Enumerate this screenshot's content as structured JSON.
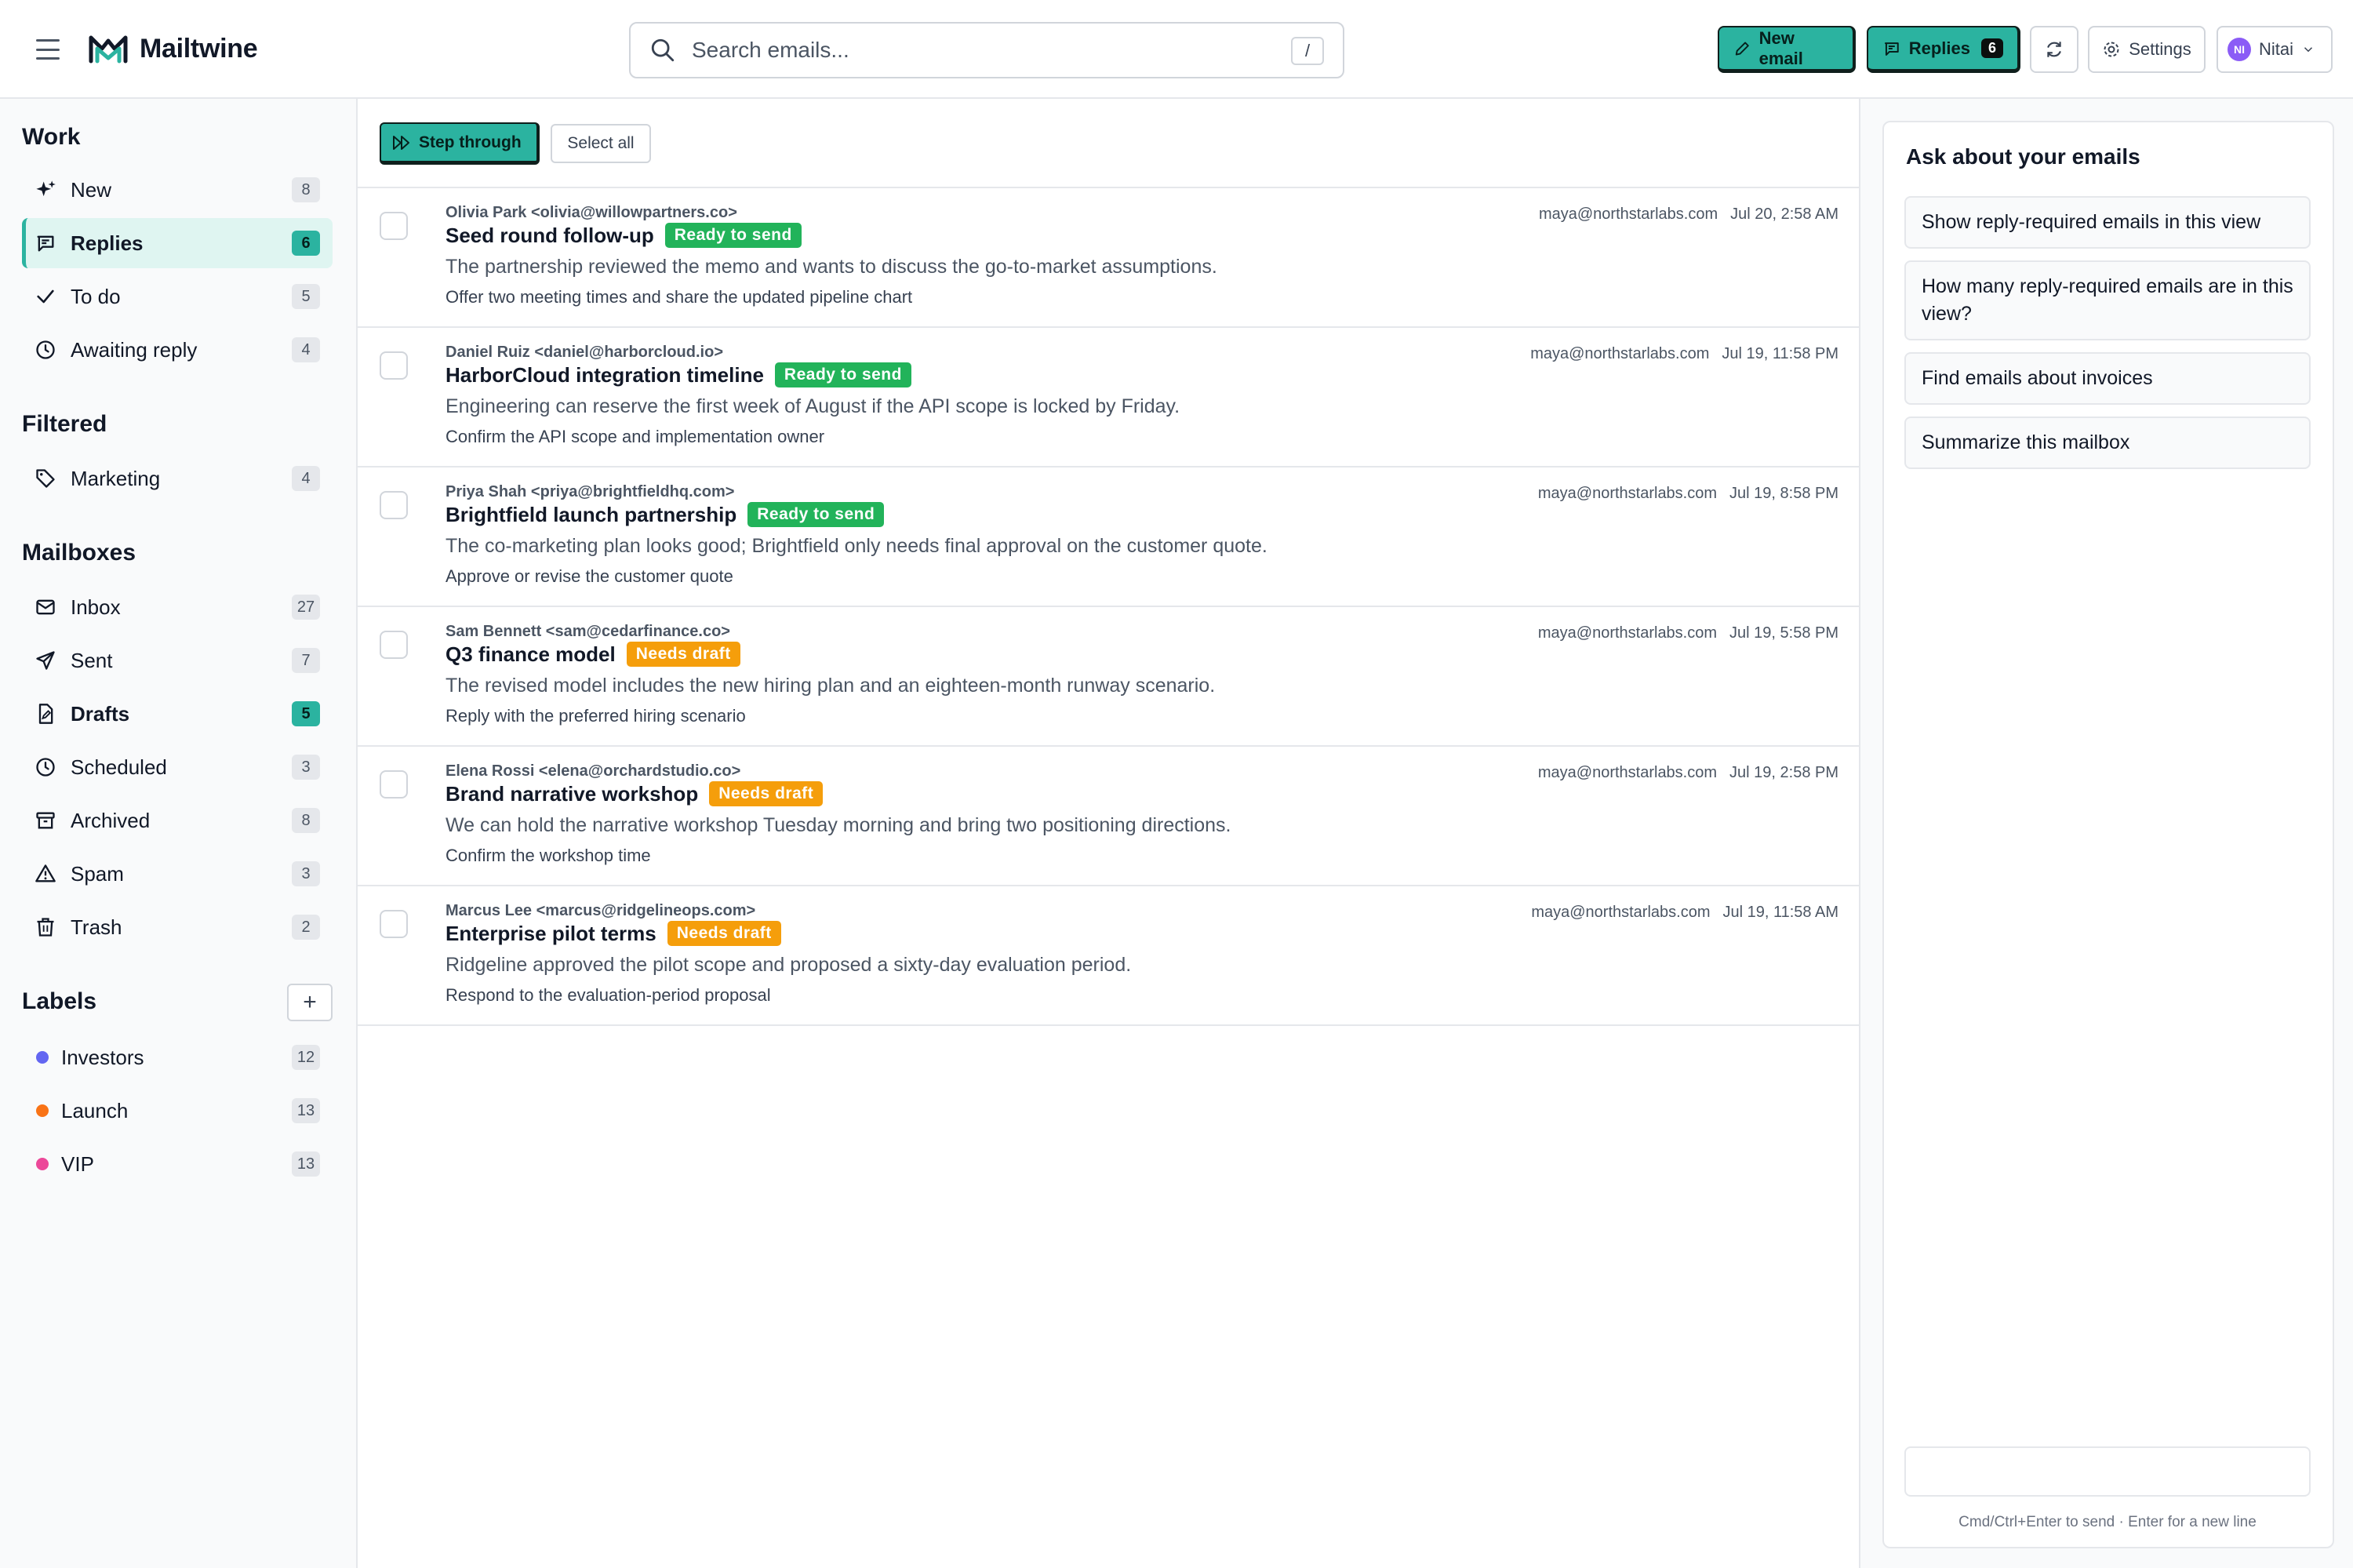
{
  "app": {
    "name": "Mailtwine"
  },
  "search": {
    "placeholder": "Search emails...",
    "shortcut": "/"
  },
  "header": {
    "new_email": "New email",
    "replies": "Replies",
    "replies_count": "6",
    "settings": "Settings",
    "user_initials": "NI",
    "user_name": "Nitai"
  },
  "sidebar": {
    "work": {
      "title": "Work",
      "items": [
        {
          "label": "New",
          "count": "8",
          "icon": "sparkle-icon"
        },
        {
          "label": "Replies",
          "count": "6",
          "icon": "reply-icon",
          "active": true
        },
        {
          "label": "To do",
          "count": "5",
          "icon": "check-icon"
        },
        {
          "label": "Awaiting reply",
          "count": "4",
          "icon": "clock-icon"
        }
      ]
    },
    "filtered": {
      "title": "Filtered",
      "items": [
        {
          "label": "Marketing",
          "count": "4",
          "icon": "tag-icon"
        }
      ]
    },
    "mailboxes": {
      "title": "Mailboxes",
      "items": [
        {
          "label": "Inbox",
          "count": "27",
          "icon": "mail-icon"
        },
        {
          "label": "Sent",
          "count": "7",
          "icon": "send-icon"
        },
        {
          "label": "Drafts",
          "count": "5",
          "icon": "draft-icon"
        },
        {
          "label": "Scheduled",
          "count": "3",
          "icon": "clock-icon"
        },
        {
          "label": "Archived",
          "count": "8",
          "icon": "archive-icon"
        },
        {
          "label": "Spam",
          "count": "3",
          "icon": "warning-icon"
        },
        {
          "label": "Trash",
          "count": "2",
          "icon": "trash-icon"
        }
      ]
    },
    "labels": {
      "title": "Labels",
      "add": "+",
      "items": [
        {
          "label": "Investors",
          "count": "12",
          "color": "#6366f1"
        },
        {
          "label": "Launch",
          "count": "13",
          "color": "#f97316"
        },
        {
          "label": "VIP",
          "count": "13",
          "color": "#ec4899"
        }
      ]
    }
  },
  "toolbar": {
    "step_through": "Step through",
    "select_all": "Select all"
  },
  "emails": [
    {
      "from": "Olivia Park <olivia@willowpartners.co>",
      "subject": "Seed round follow-up",
      "badge": "Ready to send",
      "preview": "The partnership reviewed the memo and wants to discuss the go-to-market assumptions.",
      "action": "Offer two meeting times and share the updated pipeline chart",
      "to": "maya@northstarlabs.com",
      "date": "Jul 20, 2:58 AM"
    },
    {
      "from": "Daniel Ruiz <daniel@harborcloud.io>",
      "subject": "HarborCloud integration timeline",
      "badge": "Ready to send",
      "preview": "Engineering can reserve the first week of August if the API scope is locked by Friday.",
      "action": "Confirm the API scope and implementation owner",
      "to": "maya@northstarlabs.com",
      "date": "Jul 19, 11:58 PM"
    },
    {
      "from": "Priya Shah <priya@brightfieldhq.com>",
      "subject": "Brightfield launch partnership",
      "badge": "Ready to send",
      "preview": "The co-marketing plan looks good; Brightfield only needs final approval on the customer quote.",
      "action": "Approve or revise the customer quote",
      "to": "maya@northstarlabs.com",
      "date": "Jul 19, 8:58 PM"
    },
    {
      "from": "Sam Bennett <sam@cedarfinance.co>",
      "subject": "Q3 finance model",
      "badge": "Needs draft",
      "preview": "The revised model includes the new hiring plan and an eighteen-month runway scenario.",
      "action": "Reply with the preferred hiring scenario",
      "to": "maya@northstarlabs.com",
      "date": "Jul 19, 5:58 PM"
    },
    {
      "from": "Elena Rossi <elena@orchardstudio.co>",
      "subject": "Brand narrative workshop",
      "badge": "Needs draft",
      "preview": "We can hold the narrative workshop Tuesday morning and bring two positioning directions.",
      "action": "Confirm the workshop time",
      "to": "maya@northstarlabs.com",
      "date": "Jul 19, 2:58 PM"
    },
    {
      "from": "Marcus Lee <marcus@ridgelineops.com>",
      "subject": "Enterprise pilot terms",
      "badge": "Needs draft",
      "preview": "Ridgeline approved the pilot scope and proposed a sixty-day evaluation period.",
      "action": "Respond to the evaluation-period proposal",
      "to": "maya@northstarlabs.com",
      "date": "Jul 19, 11:58 AM"
    }
  ],
  "badge_colors": {
    "Ready to send": "#22b35a",
    "Needs draft": "#f59e0b"
  },
  "assistant": {
    "title": "Ask about your emails",
    "suggestions": [
      "Show reply-required emails in this view",
      "How many reply-required emails are in this view?",
      "Find emails about invoices",
      "Summarize this mailbox"
    ],
    "input_value": "",
    "hint": "Cmd/Ctrl+Enter to send · Enter for a new line"
  },
  "colors": {
    "accent": "#2bb3a0"
  }
}
